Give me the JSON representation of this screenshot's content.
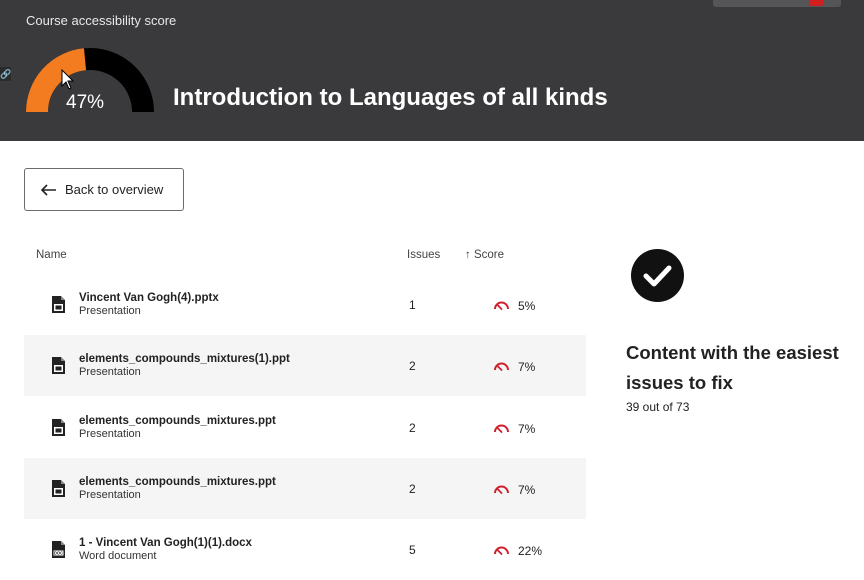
{
  "header": {
    "score_label": "Course accessibility score",
    "score_percent": "47%",
    "score_value": 0.47,
    "course_title": "Introduction to Languages of all kinds",
    "gauge_color": "#f47c20",
    "gauge_track_color": "#000000"
  },
  "back_button": {
    "label": "Back to overview",
    "icon": "arrow-left-icon"
  },
  "table": {
    "columns": {
      "name": "Name",
      "issues": "Issues",
      "score": "Score",
      "sort_icon": "arrow-up-icon"
    },
    "rows": [
      {
        "name": "Vincent Van Gogh(4).pptx",
        "type": "Presentation",
        "issues": "1",
        "score": "5%",
        "icon": "pptx-file-icon"
      },
      {
        "name": "elements_compounds_mixtures(1).ppt",
        "type": "Presentation",
        "issues": "2",
        "score": "7%",
        "icon": "ppt-file-icon"
      },
      {
        "name": "elements_compounds_mixtures.ppt",
        "type": "Presentation",
        "issues": "2",
        "score": "7%",
        "icon": "ppt-file-icon"
      },
      {
        "name": "elements_compounds_mixtures.ppt",
        "type": "Presentation",
        "issues": "2",
        "score": "7%",
        "icon": "ppt-file-icon"
      },
      {
        "name": "1 - Vincent Van Gogh(1)(1).docx",
        "type": "Word document",
        "issues": "5",
        "score": "22%",
        "icon": "doc-file-icon"
      }
    ],
    "score_indicator_color": "#d0202c"
  },
  "side_panel": {
    "icon": "check-circle-icon",
    "title": "Content with the easiest issues to fix",
    "count": "39 out of 73"
  }
}
